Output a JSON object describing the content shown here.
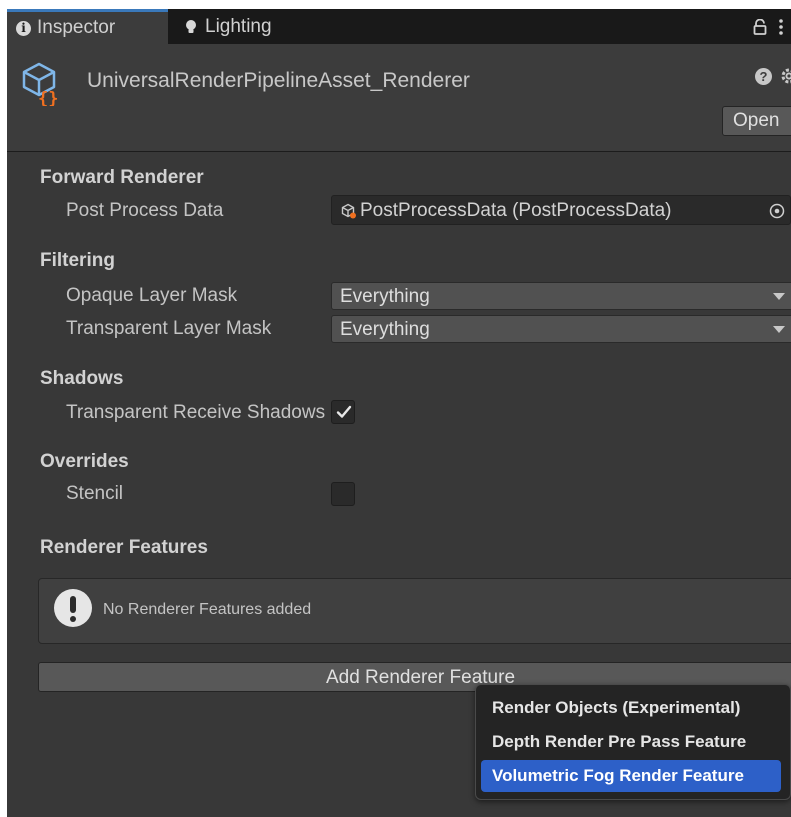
{
  "tabs": [
    {
      "label": "Inspector",
      "icon": "info-icon",
      "active": true
    },
    {
      "label": "Lighting",
      "icon": "lightbulb-icon",
      "active": false
    }
  ],
  "header": {
    "title": "UniversalRenderPipelineAsset_Renderer",
    "open_label": "Open",
    "help_glyph": "?"
  },
  "sections": {
    "forward_renderer": {
      "title": "Forward Renderer",
      "post_process_label": "Post Process Data",
      "post_process_value": "PostProcessData (PostProcessData)"
    },
    "filtering": {
      "title": "Filtering",
      "opaque_label": "Opaque Layer Mask",
      "opaque_value": "Everything",
      "transparent_label": "Transparent Layer Mask",
      "transparent_value": "Everything"
    },
    "shadows": {
      "title": "Shadows",
      "receive_label": "Transparent Receive Shadows",
      "receive_checked": true
    },
    "overrides": {
      "title": "Overrides",
      "stencil_label": "Stencil",
      "stencil_checked": false
    },
    "renderer_features": {
      "title": "Renderer Features",
      "empty_message": "No Renderer Features added",
      "add_button": "Add Renderer Feature"
    }
  },
  "menu": {
    "items": [
      {
        "label": "Render Objects (Experimental)",
        "selected": false
      },
      {
        "label": "Depth Render Pre Pass Feature",
        "selected": false
      },
      {
        "label": "Volumetric Fog Render Feature",
        "selected": true
      }
    ]
  },
  "colors": {
    "panel_bg": "#383838",
    "tab_accent": "#3a79bb",
    "menu_highlight": "#2d60c8",
    "asset_icon_accent": "#f07020"
  }
}
